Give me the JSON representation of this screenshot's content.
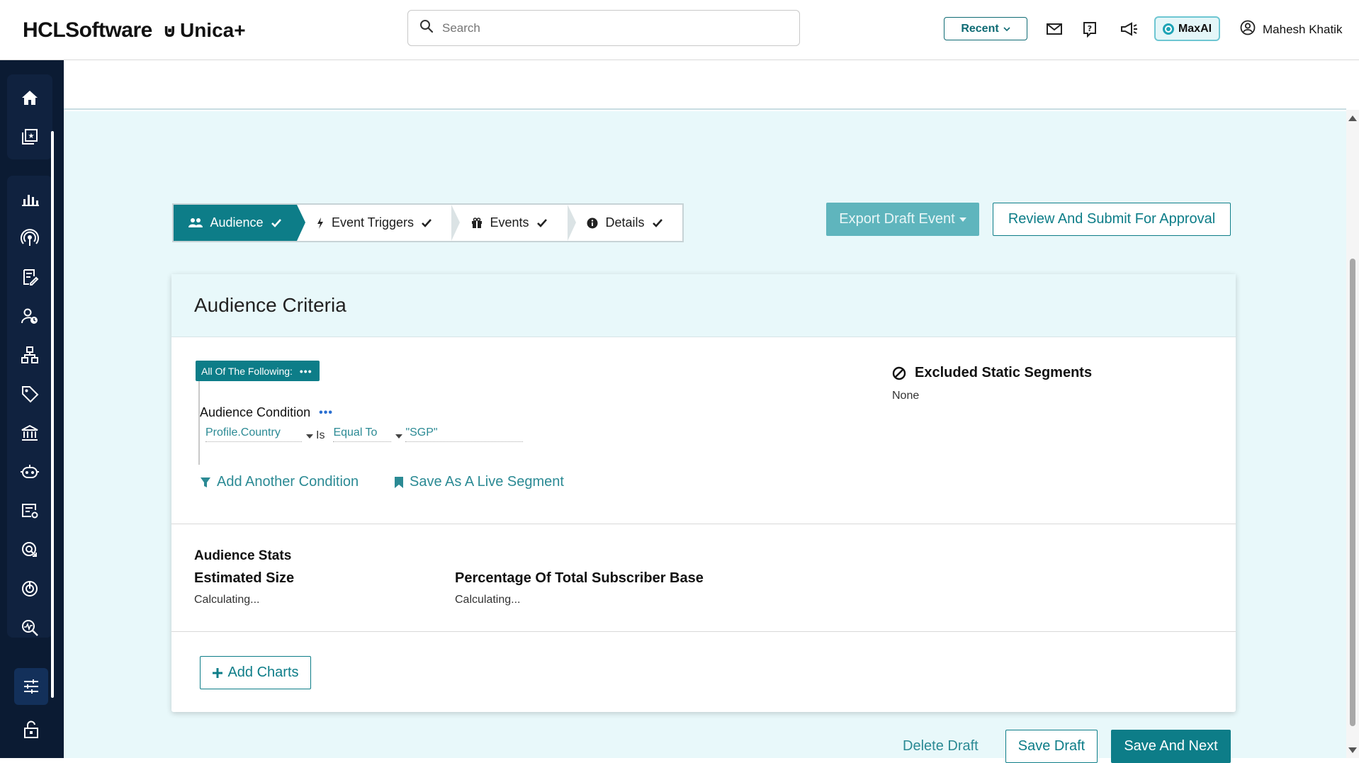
{
  "header": {
    "brand": "HCLSoftware",
    "product": "Unica+",
    "search_placeholder": "Search",
    "recent_label": "Recent",
    "maxai_label": "MaxAI",
    "user_name": "Mahesh Khatik"
  },
  "sidebar": {
    "items": [
      {
        "icon": "home-icon"
      },
      {
        "icon": "collection-star-icon"
      },
      {
        "icon": "bar-chart-icon"
      },
      {
        "icon": "broadcast-icon"
      },
      {
        "icon": "document-edit-icon"
      },
      {
        "icon": "user-clock-icon"
      },
      {
        "icon": "hierarchy-icon"
      },
      {
        "icon": "tag-icon"
      },
      {
        "icon": "bank-icon"
      },
      {
        "icon": "bot-icon"
      },
      {
        "icon": "form-settings-icon"
      },
      {
        "icon": "target-icon"
      },
      {
        "icon": "gauge-icon"
      },
      {
        "icon": "search-analytics-icon"
      }
    ],
    "bottom": [
      {
        "icon": "sliders-icon"
      },
      {
        "icon": "unlock-icon"
      }
    ]
  },
  "stepper": {
    "steps": [
      {
        "label": "Audience",
        "icon": "users-icon",
        "active": true
      },
      {
        "label": "Event Triggers",
        "icon": "bolt-icon",
        "active": false
      },
      {
        "label": "Events",
        "icon": "gift-icon",
        "active": false
      },
      {
        "label": "Details",
        "icon": "info-icon",
        "active": false
      }
    ]
  },
  "actions": {
    "export_label": "Export Draft Event",
    "review_label": "Review And Submit For Approval"
  },
  "card": {
    "title": "Audience Criteria",
    "criteria_tag": "All Of The Following:",
    "condition_title": "Audience Condition",
    "condition": {
      "field": "Profile.Country",
      "is_label": "Is",
      "operator": "Equal To",
      "value": "\"SGP\""
    },
    "add_condition_label": "Add Another Condition",
    "save_segment_label": "Save As A Live Segment",
    "excluded_title": "Excluded Static Segments",
    "excluded_value": "None",
    "stats_title": "Audience Stats",
    "estimated_size_label": "Estimated Size",
    "estimated_size_value": "Calculating...",
    "percentage_label": "Percentage Of Total Subscriber Base",
    "percentage_value": "Calculating...",
    "add_charts_label": "Add Charts"
  },
  "footer": {
    "delete_label": "Delete Draft",
    "save_draft_label": "Save Draft",
    "save_next_label": "Save And Next"
  },
  "colors": {
    "primary": "#0d7d88",
    "sidebar": "#0b1b33",
    "content_bg": "#e8f8fa"
  }
}
